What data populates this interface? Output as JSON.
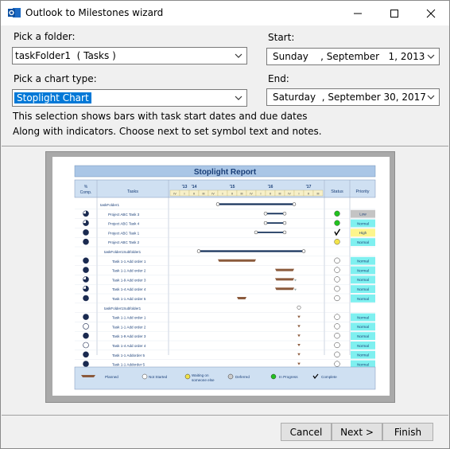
{
  "window": {
    "title": "Outlook to Milestones wizard",
    "app_icon": "outlook-app-icon"
  },
  "form": {
    "folder_label": "Pick a folder:",
    "folder_value": "taskFolder1  ( Tasks )",
    "chart_type_label": "Pick a chart type:",
    "chart_type_value": "Stoplight Chart",
    "start_label": "Start:",
    "start_value": "Sunday    , September   1, 2013",
    "end_label": "End:",
    "end_value": "Saturday  , September 30, 2017",
    "description_line1": "This selection shows bars with task start dates and due dates",
    "description_line2": "Along with indicators.  Choose next to set symbol text and notes."
  },
  "preview": {
    "title": "Stoplight Report",
    "col_comp": [
      "%",
      "Comp."
    ],
    "col_tasks": "Tasks",
    "col_status": "Status",
    "col_priority": "Priority",
    "years": [
      "'13",
      "'14",
      "'15",
      "'16",
      "'17"
    ],
    "quarters": [
      "IV",
      "I",
      "II",
      "III",
      "IV",
      "I",
      "II",
      "III",
      "IV",
      "I",
      "II",
      "III",
      "IV",
      "I",
      "II",
      "III"
    ],
    "rows": [
      {
        "name": "taskFolder1",
        "pie": "",
        "status": "",
        "priority": "",
        "indent": 0
      },
      {
        "name": "Project ABC Task 3",
        "pie": "75",
        "status": "green",
        "priority": "Low",
        "indent": 2
      },
      {
        "name": "Project ABC Task 4",
        "pie": "75",
        "status": "green",
        "priority": "Normal",
        "indent": 2
      },
      {
        "name": "Project ABC Task 1",
        "pie": "100",
        "status": "check",
        "priority": "High",
        "indent": 2
      },
      {
        "name": "Project ABC Task 2",
        "pie": "100",
        "status": "yellow",
        "priority": "Normal",
        "indent": 2
      },
      {
        "name": "taskFolder1Subfolder1",
        "pie": "",
        "status": "",
        "priority": "",
        "indent": 1
      },
      {
        "name": "Task 1-1 Add order 1",
        "pie": "100",
        "status": "white",
        "priority": "Normal",
        "indent": 3
      },
      {
        "name": "Task 1-1 Add order 2",
        "pie": "100",
        "status": "white",
        "priority": "Normal",
        "indent": 3
      },
      {
        "name": "Task 1-9 Add order 3",
        "pie": "75",
        "status": "white",
        "priority": "Normal",
        "indent": 3
      },
      {
        "name": "Task 1-4 Add order 4",
        "pie": "75",
        "status": "white",
        "priority": "Normal",
        "indent": 3
      },
      {
        "name": "Task 1-1 Add order 5",
        "pie": "100",
        "status": "white",
        "priority": "Normal",
        "indent": 3
      },
      {
        "name": "taskFolder1Subfolder1",
        "pie": "",
        "status": "",
        "priority": "",
        "indent": 1
      },
      {
        "name": "Task 1-1 Add order 1",
        "pie": "100",
        "status": "white",
        "priority": "Normal",
        "indent": 3
      },
      {
        "name": "Task 1-1 Add order 2",
        "pie": "0",
        "status": "white",
        "priority": "Normal",
        "indent": 3
      },
      {
        "name": "Task 1-9 Add order 3",
        "pie": "100",
        "status": "white",
        "priority": "Normal",
        "indent": 3
      },
      {
        "name": "Task 1-4 Add order 4",
        "pie": "0",
        "status": "white",
        "priority": "Normal",
        "indent": 3
      },
      {
        "name": "Task 1-1 Addorder 5",
        "pie": "100",
        "status": "white",
        "priority": "Normal",
        "indent": 3
      },
      {
        "name": "Task 1-1 Addorder 5",
        "pie": "100",
        "status": "white",
        "priority": "Normal",
        "indent": 3
      }
    ],
    "legend": {
      "planned": "Planned",
      "not_started": "Not Started",
      "waiting": [
        "Waiting on",
        "someone else"
      ],
      "deferred": "Deferred",
      "in_progress": "In Progress",
      "complete": "Complete"
    },
    "colors": {
      "green": "#22c11f",
      "yellow": "#f2e34a",
      "low": "#c4c4c4",
      "high": "#fdf58d",
      "normal": "#7ff0f0",
      "header": "#cfe0f2",
      "title_band": "#aac6e6",
      "bar": "#17335c"
    }
  },
  "buttons": {
    "cancel": "Cancel",
    "next": "Next >",
    "finish": "Finish"
  }
}
